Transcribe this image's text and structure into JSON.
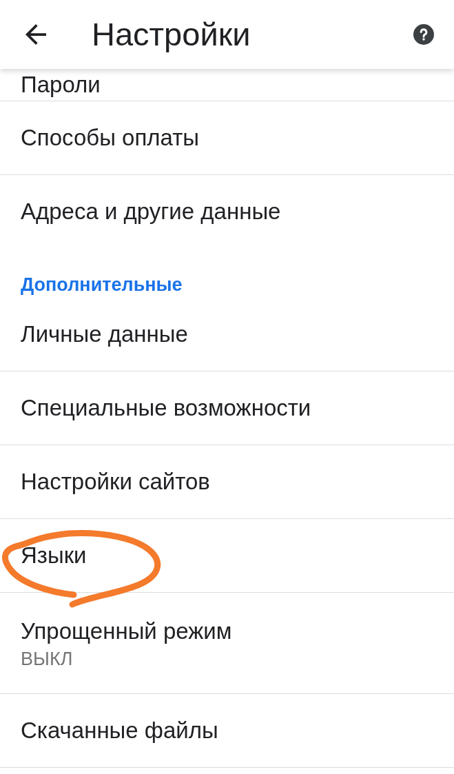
{
  "app_bar": {
    "title": "Настройки"
  },
  "items": [
    {
      "kind": "item",
      "title": "Пароли",
      "circled": false
    },
    {
      "kind": "item",
      "title": "Способы оплаты",
      "circled": false
    },
    {
      "kind": "item",
      "title": "Адреса и другие данные",
      "circled": false
    },
    {
      "kind": "section",
      "title": "Дополнительные",
      "circled": false
    },
    {
      "kind": "item",
      "title": "Личные данные",
      "circled": false
    },
    {
      "kind": "item",
      "title": "Специальные возможности",
      "circled": false
    },
    {
      "kind": "item",
      "title": "Настройки сайтов",
      "circled": false
    },
    {
      "kind": "item",
      "title": "Языки",
      "circled": true
    },
    {
      "kind": "item",
      "title": "Упрощенный режим",
      "subtitle": "ВЫКЛ",
      "circled": false
    },
    {
      "kind": "item",
      "title": "Скачанные файлы",
      "circled": false
    }
  ]
}
